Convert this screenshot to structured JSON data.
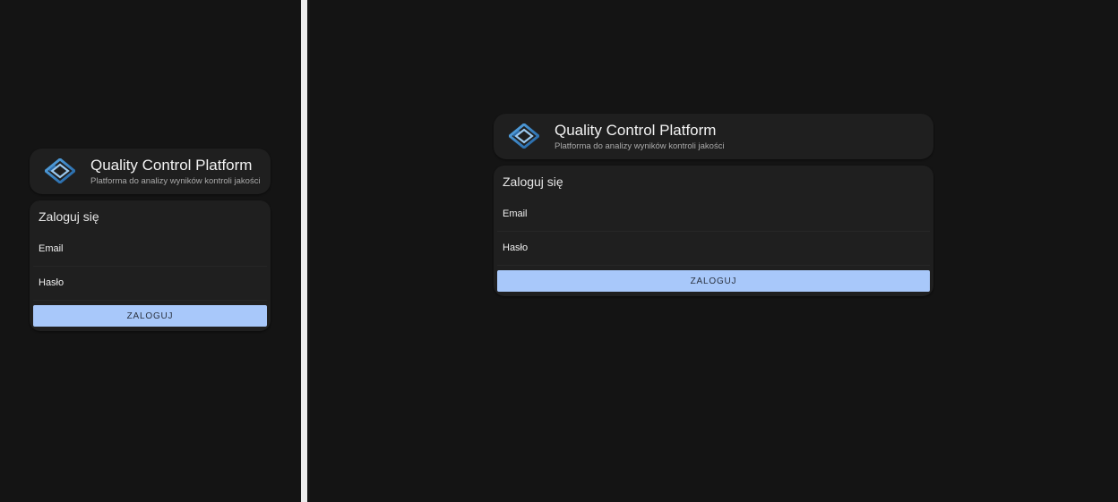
{
  "app": {
    "title": "Quality Control Platform",
    "subtitle": "Platforma do analizy wyników kontroli jakości",
    "logo_icon": "diamond-logo-icon"
  },
  "login": {
    "heading": "Zaloguj się",
    "email_label": "Email",
    "password_label": "Hasło",
    "submit_label": "ZALOGUJ"
  },
  "colors": {
    "background": "#141414",
    "card": "#1f1f1f",
    "divider": "#ececec",
    "button": "#a8c8fa",
    "logo_blue": "#3a86c8"
  }
}
